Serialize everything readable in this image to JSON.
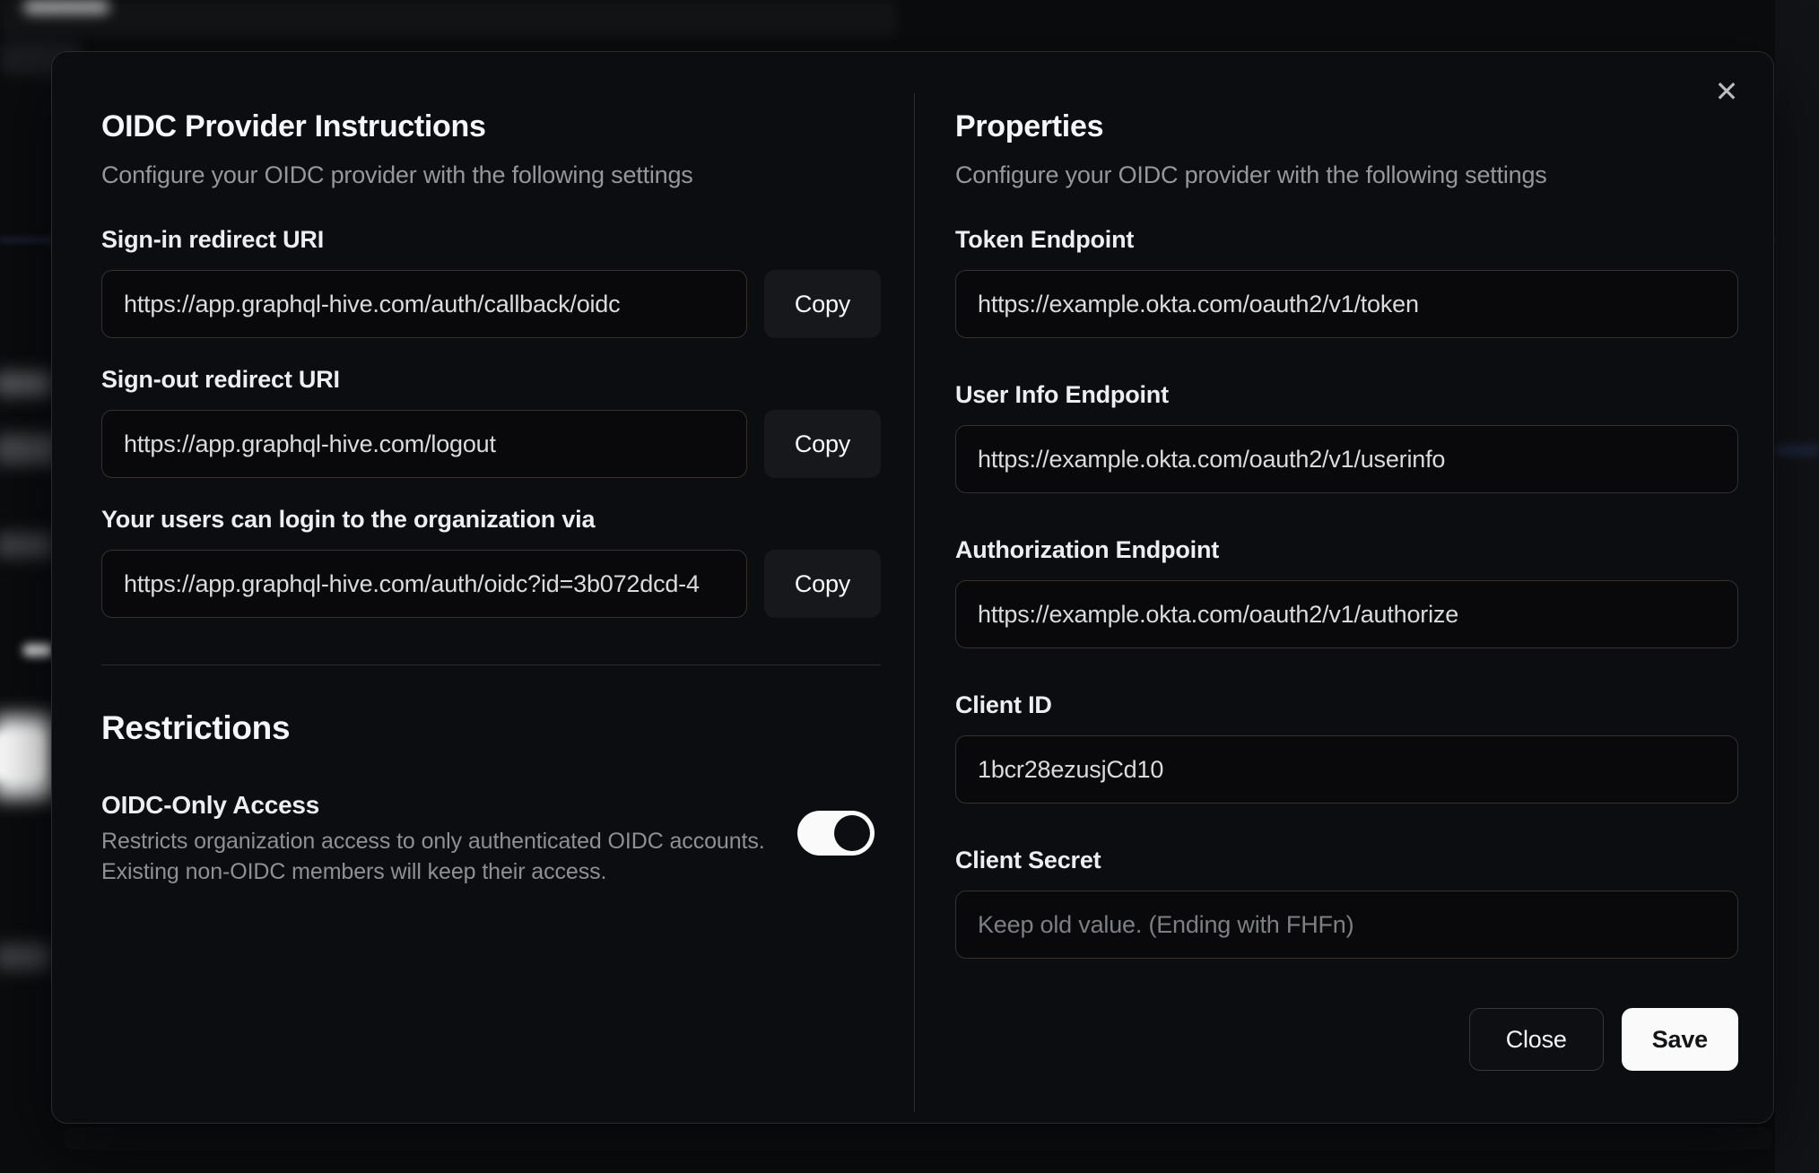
{
  "modal": {
    "close_glyph": "✕",
    "left": {
      "title": "OIDC Provider Instructions",
      "subtitle": "Configure your OIDC provider with the following settings",
      "fields": [
        {
          "label": "Sign-in redirect URI",
          "value": "https://app.graphql-hive.com/auth/callback/oidc",
          "button": "Copy"
        },
        {
          "label": "Sign-out redirect URI",
          "value": "https://app.graphql-hive.com/logout",
          "button": "Copy"
        },
        {
          "label": "Your users can login to the organization via",
          "value": "https://app.graphql-hive.com/auth/oidc?id=3b072dcd-4",
          "button": "Copy"
        }
      ],
      "restrictions": {
        "title": "Restrictions",
        "toggle_label": "OIDC-Only Access",
        "description_line1": "Restricts organization access to only authenticated OIDC accounts.",
        "description_line2": "Existing non-OIDC members will keep their access.",
        "toggle_state": "on"
      }
    },
    "right": {
      "title": "Properties",
      "subtitle": "Configure your OIDC provider with the following settings",
      "fields": [
        {
          "label": "Token Endpoint",
          "value": "https://example.okta.com/oauth2/v1/token"
        },
        {
          "label": "User Info Endpoint",
          "value": "https://example.okta.com/oauth2/v1/userinfo"
        },
        {
          "label": "Authorization Endpoint",
          "value": "https://example.okta.com/oauth2/v1/authorize"
        },
        {
          "label": "Client ID",
          "value": "1bcr28ezusjCd10"
        },
        {
          "label": "Client Secret",
          "value": "",
          "placeholder": "Keep old value. (Ending with FHFn)"
        }
      ],
      "buttons": {
        "close": "Close",
        "save": "Save"
      }
    },
    "colors": {
      "page_background": "#0b0c0e",
      "modal_background": "#0c0d10",
      "input_background": "#09090b",
      "input_border": "#363129",
      "copy_button_background": "#17181c",
      "save_button_background": "#fafafa",
      "toggle_track_on": "#fafafa",
      "toggle_knob": "#0d0e11",
      "heading_text": "#f5f6f7",
      "muted_text": "#95979a"
    }
  }
}
